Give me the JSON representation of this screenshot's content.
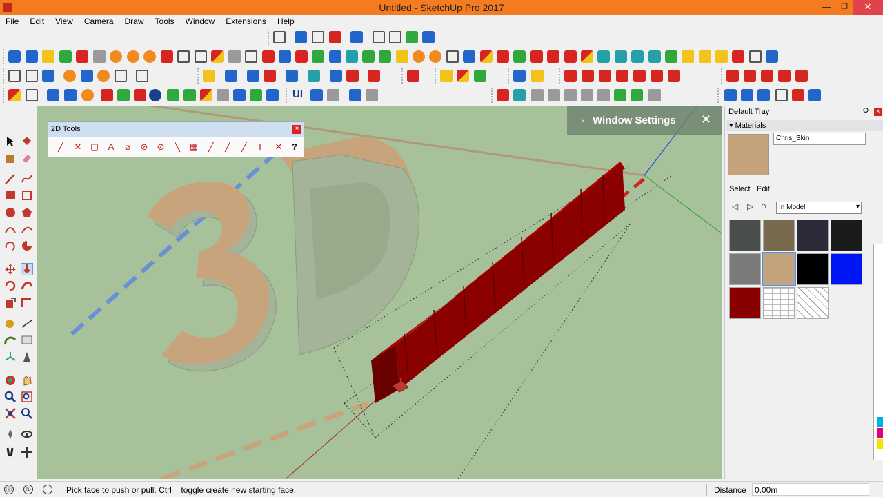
{
  "window": {
    "title": "Untitled - SketchUp Pro 2017",
    "minimize": "—",
    "maximize": "❐",
    "close": "✕"
  },
  "menu": {
    "items": [
      "File",
      "Edit",
      "View",
      "Camera",
      "Draw",
      "Tools",
      "Window",
      "Extensions",
      "Help"
    ]
  },
  "toolbars": {
    "row4_labels": [
      "UI"
    ]
  },
  "tools2d": {
    "title": "2D Tools",
    "close": "×",
    "glyphs": [
      "╱",
      "✕",
      "▢",
      "A",
      "⌀",
      "⊘",
      "⊘",
      "╲",
      "▦",
      "╱",
      "╱",
      "╱",
      "T",
      "✕",
      "?"
    ]
  },
  "window_settings": {
    "label": "Window Settings",
    "arrow": "→",
    "close": "✕"
  },
  "tray": {
    "title": "Default Tray",
    "pin": "⭘",
    "close": "×",
    "panel_title": "Materials",
    "material_name": "Chris_Skin",
    "tab_select": "Select",
    "tab_edit": "Edit",
    "dropdown_value": "In Model",
    "swatches": [
      {
        "color": "#4a4e4c"
      },
      {
        "color": "#776a4d"
      },
      {
        "color": "#2b2b3a"
      },
      {
        "color": "#1a1b1c"
      },
      {
        "color": "#7b7b7b"
      },
      {
        "color": "#c4a27c",
        "selected": true
      },
      {
        "color": "#000000"
      },
      {
        "color": "#0016f5"
      },
      {
        "color": "#8a0000"
      },
      {
        "color": "#ffffff",
        "pattern": "brick"
      },
      {
        "color": "#ffffff",
        "pattern": "hatch"
      }
    ]
  },
  "statusbar": {
    "message": "Pick face to push or pull.  Ctrl = toggle create new starting face.",
    "distance_label": "Distance",
    "distance_value": "0.00m",
    "icons": [
      "ⓘ",
      "①"
    ]
  },
  "scene": {
    "text_3d": "3D",
    "colors": {
      "background": "#a7c19a",
      "extrusion_face": "#c7a47b",
      "extrusion_side": "#a3b499",
      "bars": "#8b0000",
      "axis_red": "#cc2a2a",
      "axis_green": "#2aa02a",
      "axis_blue": "#2a55cc"
    }
  }
}
